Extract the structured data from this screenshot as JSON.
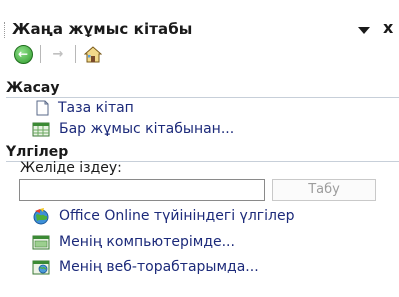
{
  "pane": {
    "title": "Жаңа жұмыс кітабы",
    "dropdown_icon": "triangle-down",
    "close_label": "x"
  },
  "nav": {
    "back_icon": "back-arrow",
    "forward_icon": "forward-arrow",
    "home_icon": "home"
  },
  "create_section": {
    "heading": "Жасау",
    "items": [
      {
        "label": "Таза кітап",
        "icon": "blank-document"
      },
      {
        "label": "Бар жұмыс кітабынан...",
        "icon": "workbook-from-existing"
      }
    ]
  },
  "templates_section": {
    "heading": "Үлгілер",
    "search_label": "Желіде іздеу:",
    "search_value": "",
    "search_button": "Табу",
    "items": [
      {
        "label": "Office Online түйініндегі үлгілер",
        "icon": "office-online-globe"
      },
      {
        "label": "Менің компьютерімде...",
        "icon": "my-computer-templates"
      },
      {
        "label": "Менің веб-торабтарымда...",
        "icon": "my-websites-templates"
      }
    ]
  },
  "colors": {
    "link": "#1c2a7a",
    "accent_green": "#2f9a2c",
    "disabled_text": "#9c9c9c"
  }
}
